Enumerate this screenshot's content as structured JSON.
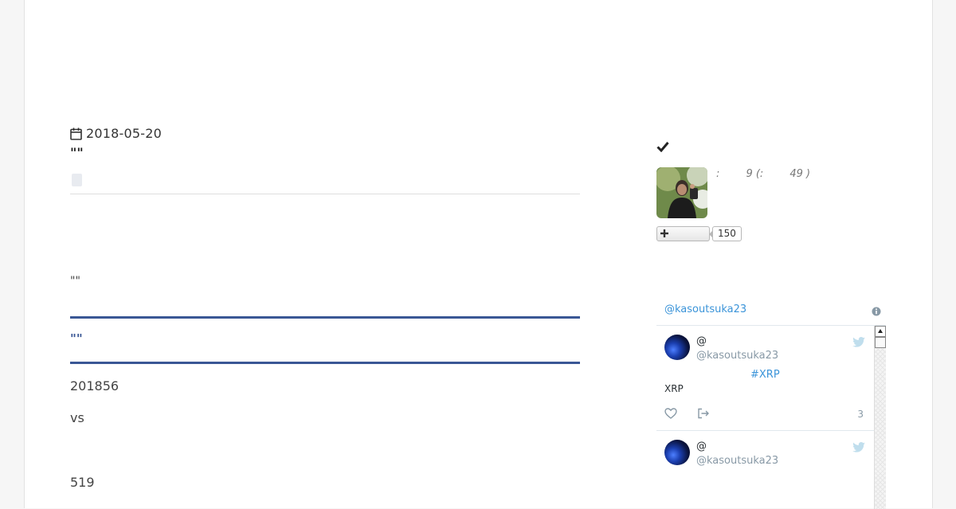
{
  "article": {
    "date": "2018-05-20",
    "title": "\"\"",
    "quote": "\"\"",
    "section_heading": "\"\"",
    "paragraphs": [
      "201856",
      "vs",
      "519"
    ]
  },
  "profile": {
    "rank_text": ":        9 (:        49 )",
    "follow_count": "150"
  },
  "twitter_widget": {
    "header_handle": "@kasoutsuka23",
    "tweets": [
      {
        "name": "@",
        "screen_name": "@kasoutsuka23",
        "hashtag": "#XRP",
        "text": "XRP",
        "time": "3"
      },
      {
        "name": "@",
        "screen_name": "@kasoutsuka23"
      }
    ]
  },
  "colors": {
    "accent_blue": "#3a5795",
    "twitter_link": "#3b94d9",
    "twitter_icon": "#c0deed"
  }
}
